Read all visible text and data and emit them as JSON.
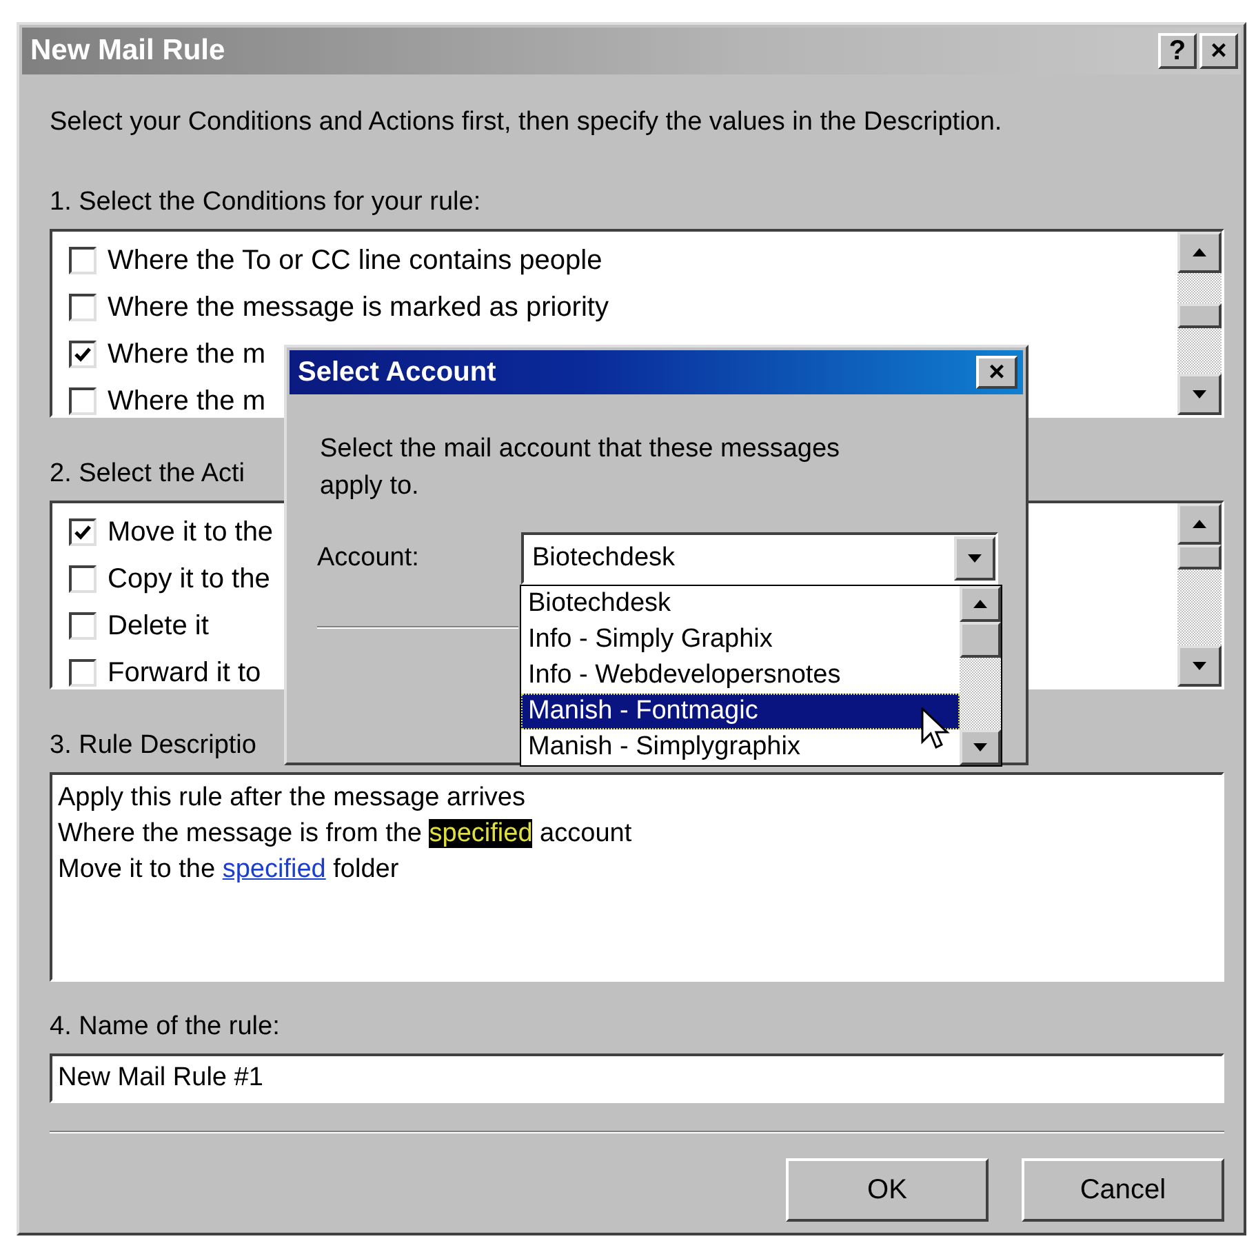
{
  "window": {
    "title": "New Mail Rule",
    "title_buttons": [
      "?",
      "×"
    ]
  },
  "intro": "Select your Conditions and Actions first, then specify the values in the Description.",
  "conditions": {
    "label": "1. Select the Conditions for your rule:",
    "items": [
      {
        "text": "Where the To or CC line contains people",
        "checked": false
      },
      {
        "text": "Where the message is marked as priority",
        "checked": false
      },
      {
        "text": "Where the m",
        "checked": true
      },
      {
        "text": "Where the m",
        "checked": false
      }
    ]
  },
  "actions": {
    "label": "2. Select the Acti",
    "items": [
      {
        "text": "Move it to the",
        "checked": true
      },
      {
        "text": "Copy it to the",
        "checked": false
      },
      {
        "text": "Delete it",
        "checked": false
      },
      {
        "text": "Forward it to",
        "checked": false
      }
    ]
  },
  "description": {
    "label": "3. Rule Descriptio",
    "lines": [
      [
        {
          "kind": "plain",
          "text": "Apply this rule after the message arrives"
        }
      ],
      [
        {
          "kind": "plain",
          "text": "Where the message is from the "
        },
        {
          "kind": "highlight",
          "text": "specified"
        },
        {
          "kind": "plain",
          "text": " account"
        }
      ],
      [
        {
          "kind": "plain",
          "text": "Move it to the "
        },
        {
          "kind": "link",
          "text": "specified"
        },
        {
          "kind": "plain",
          "text": " folder"
        }
      ]
    ]
  },
  "rule_name": {
    "label": "4. Name of the rule:",
    "value": "New Mail Rule #1"
  },
  "buttons": [
    "OK",
    "Cancel"
  ],
  "select_account": {
    "title": "Select Account",
    "close": "×",
    "message": "Select the mail account that these messages apply to.",
    "account_label": "Account:",
    "account_value": "Biotechdesk",
    "options": [
      {
        "text": "Biotechdesk",
        "selected": false
      },
      {
        "text": "Info - Simply Graphix",
        "selected": false
      },
      {
        "text": "Info - Webdevelopersnotes",
        "selected": false
      },
      {
        "text": "Manish - Fontmagic",
        "selected": true
      },
      {
        "text": "Manish - Simplygraphix",
        "selected": false
      }
    ]
  }
}
